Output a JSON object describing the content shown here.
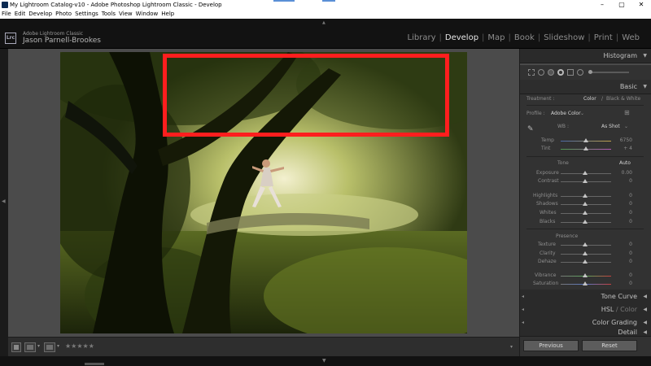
{
  "window": {
    "title": "My Lightroom Catalog-v10 - Adobe Photoshop Lightroom Classic - Develop",
    "controls": [
      "–",
      "▢",
      "✕"
    ]
  },
  "menu": [
    "File",
    "Edit",
    "Develop",
    "Photo",
    "Settings",
    "Tools",
    "View",
    "Window",
    "Help"
  ],
  "identity": {
    "badge": "Lrc",
    "product": "Adobe Lightroom Classic",
    "user": "Jason Parnell-Brookes"
  },
  "modules": [
    "Library",
    "Develop",
    "Map",
    "Book",
    "Slideshow",
    "Print",
    "Web"
  ],
  "active_module": "Develop",
  "panels": {
    "histogram": "Histogram",
    "basic": "Basic",
    "treatment_label": "Treatment :",
    "treatment_color": "Color",
    "treatment_bw": "Black & White",
    "profile_label": "Profile :",
    "profile_value": "Adobe Color",
    "wb_label": "WB :",
    "wb_value": "As Shot",
    "temp": {
      "label": "Temp",
      "value": "6750",
      "position": 0.52
    },
    "tint": {
      "label": "Tint",
      "value": "+ 4",
      "position": 0.52
    },
    "tone_label": "Tone",
    "auto_label": "Auto",
    "exposure": {
      "label": "Exposure",
      "value": "0.00",
      "position": 0.5
    },
    "contrast": {
      "label": "Contrast",
      "value": "0",
      "position": 0.5
    },
    "highlights": {
      "label": "Highlights",
      "value": "0",
      "position": 0.5
    },
    "shadows": {
      "label": "Shadows",
      "value": "0",
      "position": 0.5
    },
    "whites": {
      "label": "Whites",
      "value": "0",
      "position": 0.5
    },
    "blacks": {
      "label": "Blacks",
      "value": "0",
      "position": 0.5
    },
    "presence_label": "Presence",
    "texture": {
      "label": "Texture",
      "value": "0",
      "position": 0.5
    },
    "clarity": {
      "label": "Clarity",
      "value": "0",
      "position": 0.5
    },
    "dehaze": {
      "label": "Dehaze",
      "value": "0",
      "position": 0.5
    },
    "vibrance": {
      "label": "Vibrance",
      "value": "0",
      "position": 0.5
    },
    "saturation": {
      "label": "Saturation",
      "value": "0",
      "position": 0.5
    },
    "tone_curve": "Tone Curve",
    "hsl": "HSL",
    "hsl_sep": "/",
    "hsl_color": "Color",
    "color_grading": "Color Grading",
    "detail": "Detail",
    "previous": "Previous",
    "reset": "Reset"
  },
  "toolbar": {
    "stars": "★★★★★"
  },
  "colors": {
    "highlight_box": "#ff1e1e",
    "panel_bg": "#323232",
    "canvas_bg": "#4b4b4b"
  }
}
